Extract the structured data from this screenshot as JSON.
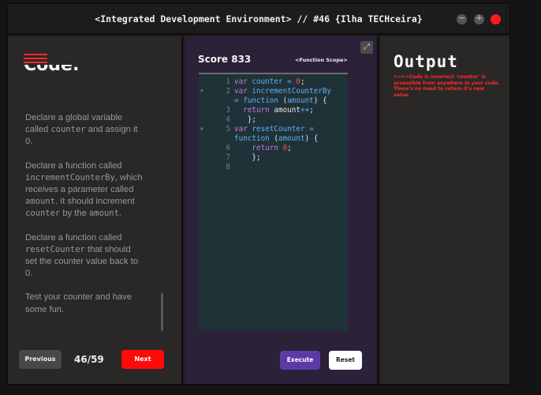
{
  "window": {
    "title": "<Integrated Development Environment> // #46 {Ilha TECHceira}",
    "min_label": "−",
    "max_label": "+",
    "colors": {
      "close": "#ff1a1a",
      "accent": "#ff0a0a",
      "execute": "#5b3aa6"
    }
  },
  "left": {
    "heading": "Code:",
    "instructions": [
      [
        "Declare a global variable called ",
        "counter",
        " and assign it 0."
      ],
      [
        "Declare a function called ",
        "incrementCounterBy",
        ", which receives a parameter called ",
        "amount",
        ". It should increment ",
        "counter",
        " by the ",
        "amount",
        "."
      ],
      [
        "Declare a function called ",
        "resetCounter",
        " that should set the counter value back to 0."
      ],
      [
        "Test your counter and have some fun."
      ]
    ],
    "prev_label": "Previous",
    "counter": "46/59",
    "next_label": "Next"
  },
  "middle": {
    "score": "Score 833",
    "scope": "<Function Scope>",
    "expand_icon": "expand-icon",
    "code_lines": [
      {
        "n": "1",
        "fold": false,
        "tokens": [
          [
            "kw",
            "var "
          ],
          [
            "id",
            "counter"
          ],
          [
            "op",
            " = "
          ],
          [
            "num",
            "0"
          ],
          [
            "pl",
            ";"
          ]
        ]
      },
      {
        "n": "2",
        "fold": true,
        "tokens": [
          [
            "kw",
            "var "
          ],
          [
            "id",
            "incrementCounterBy"
          ]
        ]
      },
      {
        "n": "",
        "fold": false,
        "tokens": [
          [
            "op",
            "= "
          ],
          [
            "id",
            "function "
          ],
          [
            "pl",
            "("
          ],
          [
            "id",
            "amount"
          ],
          [
            "pl",
            ") {"
          ]
        ]
      },
      {
        "n": "3",
        "fold": false,
        "tokens": [
          [
            "pl",
            "  "
          ],
          [
            "kw",
            "return "
          ],
          [
            "pl",
            "amount"
          ],
          [
            "op",
            "++"
          ],
          [
            "pl",
            ";"
          ]
        ]
      },
      {
        "n": "4",
        "fold": false,
        "tokens": [
          [
            "pl",
            "   };"
          ]
        ]
      },
      {
        "n": "5",
        "fold": true,
        "tokens": [
          [
            "kw",
            "var "
          ],
          [
            "id",
            "resetCounter "
          ],
          [
            "op",
            "="
          ]
        ]
      },
      {
        "n": "",
        "fold": false,
        "tokens": [
          [
            "id",
            "function "
          ],
          [
            "pl",
            "("
          ],
          [
            "id",
            "amount"
          ],
          [
            "pl",
            ") {"
          ]
        ]
      },
      {
        "n": "6",
        "fold": false,
        "tokens": [
          [
            "pl",
            "    "
          ],
          [
            "kw",
            "return "
          ],
          [
            "num",
            "0"
          ],
          [
            "pl",
            ";"
          ]
        ]
      },
      {
        "n": "7",
        "fold": false,
        "tokens": [
          [
            "pl",
            "    };"
          ]
        ]
      },
      {
        "n": "8",
        "fold": false,
        "tokens": []
      }
    ],
    "execute_label": "Execute",
    "reset_label": "Reset"
  },
  "right": {
    "title": "Output",
    "message": ">>>>Code is incorrect 'counter' is accessible from anywhere in your code. There's no need to return it's new value."
  }
}
